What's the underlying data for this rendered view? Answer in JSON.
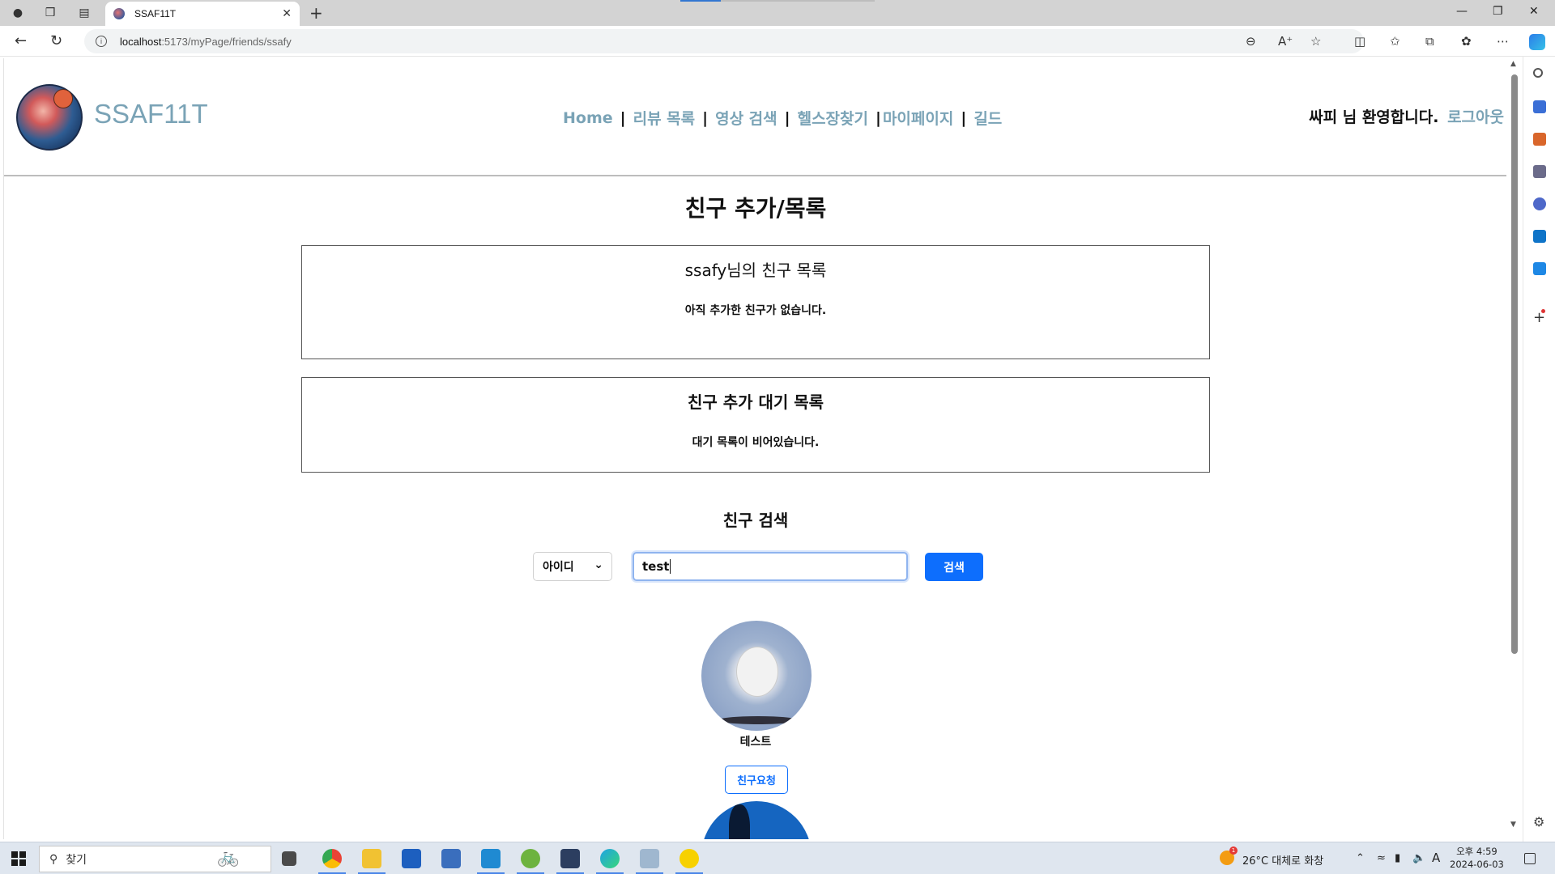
{
  "browser": {
    "tab_title": "SSAF11T",
    "url_host": "localhost",
    "url_path": ":5173/myPage/friends/ssafy"
  },
  "header": {
    "site_name": "SSAF11T",
    "nav": [
      "Home",
      "리뷰 목록",
      "영상 검색",
      "헬스장찾기",
      "마이페이지",
      "길드"
    ],
    "welcome": "싸피 님 환영합니다.",
    "logout": "로그아웃"
  },
  "main": {
    "title": "친구 추가/목록",
    "friends_box": {
      "title": "ssafy님의 친구 목록",
      "empty_text": "아직 추가한 친구가 없습니다."
    },
    "pending_box": {
      "title": "친구 추가 대기 목록",
      "empty_text": "대기 목록이 비어있습니다."
    },
    "search": {
      "title": "친구 검색",
      "select_value": "아이디",
      "input_value": "test",
      "button": "검색"
    },
    "result": {
      "name": "테스트",
      "request_button": "친구요청"
    }
  },
  "taskbar": {
    "search_placeholder": "찾기",
    "weather": "26°C  대체로 화창",
    "weather_badge": "1",
    "clock_time": "오후 4:59",
    "clock_date": "2024-06-03",
    "ime": "A"
  },
  "colors": {
    "accent": "#7aa3b6",
    "primary_button": "#0d6efd"
  },
  "icons": [
    "profile-icon",
    "collections-icon",
    "tab-actions-icon",
    "close-icon",
    "new-tab-icon",
    "back-icon",
    "refresh-icon",
    "info-icon",
    "zoom-icon",
    "read-aloud-icon",
    "favorite-star-icon",
    "split-screen-icon",
    "favorites-icon",
    "collections-icon",
    "extensions-icon",
    "more-icon",
    "copilot-icon"
  ]
}
